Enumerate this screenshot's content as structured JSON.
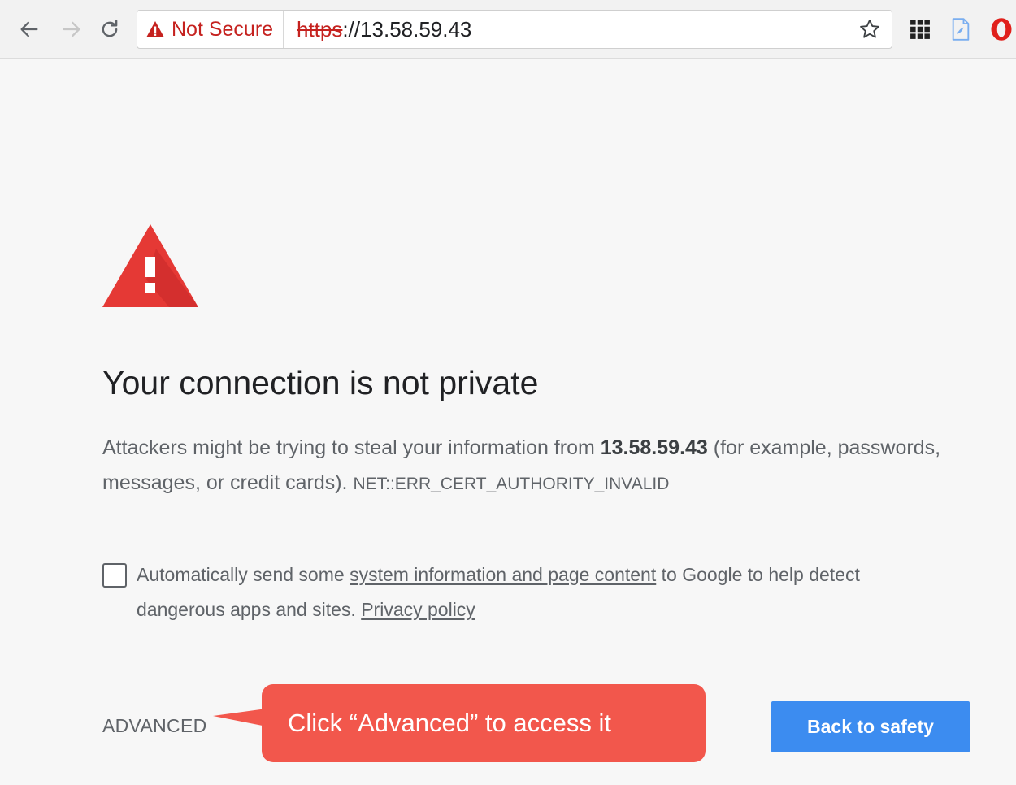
{
  "toolbar": {
    "security_label": "Not Secure",
    "url_scheme": "https",
    "url_rest": "://13.58.59.43",
    "icons": {
      "back": "back-arrow-icon",
      "forward": "forward-arrow-icon",
      "reload": "reload-icon",
      "warning": "warning-triangle-icon",
      "bookmark": "star-icon",
      "ext1": "grid-extension-icon",
      "ext2": "page-extension-icon",
      "ext3": "opera-icon"
    }
  },
  "interstitial": {
    "title": "Your connection is not private",
    "body_prefix": "Attackers might be trying to steal your information from ",
    "host": "13.58.59.43",
    "body_suffix": " (for example, passwords, messages, or credit cards). ",
    "error_code": "NET::ERR_CERT_AUTHORITY_INVALID",
    "optin_prefix": "Automatically send some ",
    "optin_link": "system information and page content",
    "optin_middle": " to Google to help detect dangerous apps and sites. ",
    "privacy_link": "Privacy policy",
    "optin_checked": false,
    "advanced_label": "ADVANCED",
    "back_label": "Back to safety"
  },
  "annotation": {
    "text": "Click “Advanced” to access it"
  },
  "colors": {
    "warning_red": "#e53935",
    "insecure_red": "#c5221f",
    "primary_blue": "#3c8cf0",
    "callout_red": "#f2574c",
    "page_bg": "#f7f7f7"
  }
}
